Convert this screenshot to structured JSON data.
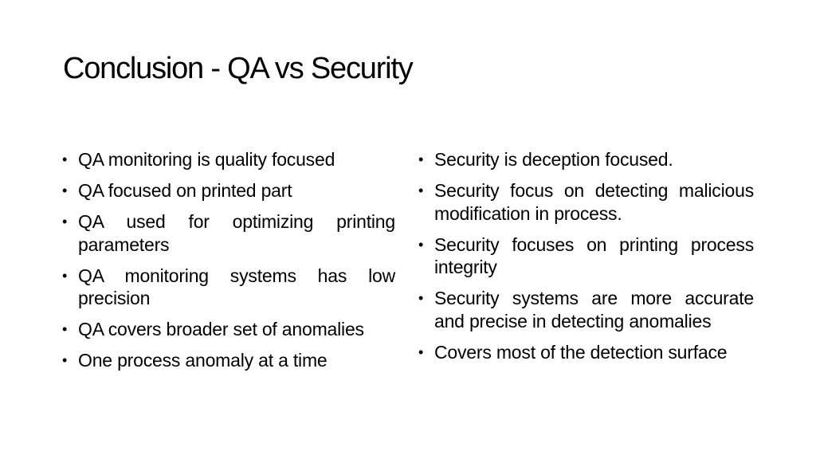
{
  "slide": {
    "title": "Conclusion - QA vs Security",
    "bullet_glyph": "•",
    "left_column": {
      "items": [
        "QA monitoring is quality focused",
        "QA focused on printed part",
        "QA used for optimizing printing parameters",
        "QA monitoring systems has low precision",
        "QA covers broader set of anomalies",
        "One process anomaly at a time"
      ]
    },
    "right_column": {
      "items": [
        "Security is deception focused.",
        "Security focus on detecting malicious modification in process.",
        "Security focuses on printing process integrity",
        "Security systems are more accurate and precise in detecting anomalies",
        "Covers most of the detection surface"
      ]
    }
  }
}
